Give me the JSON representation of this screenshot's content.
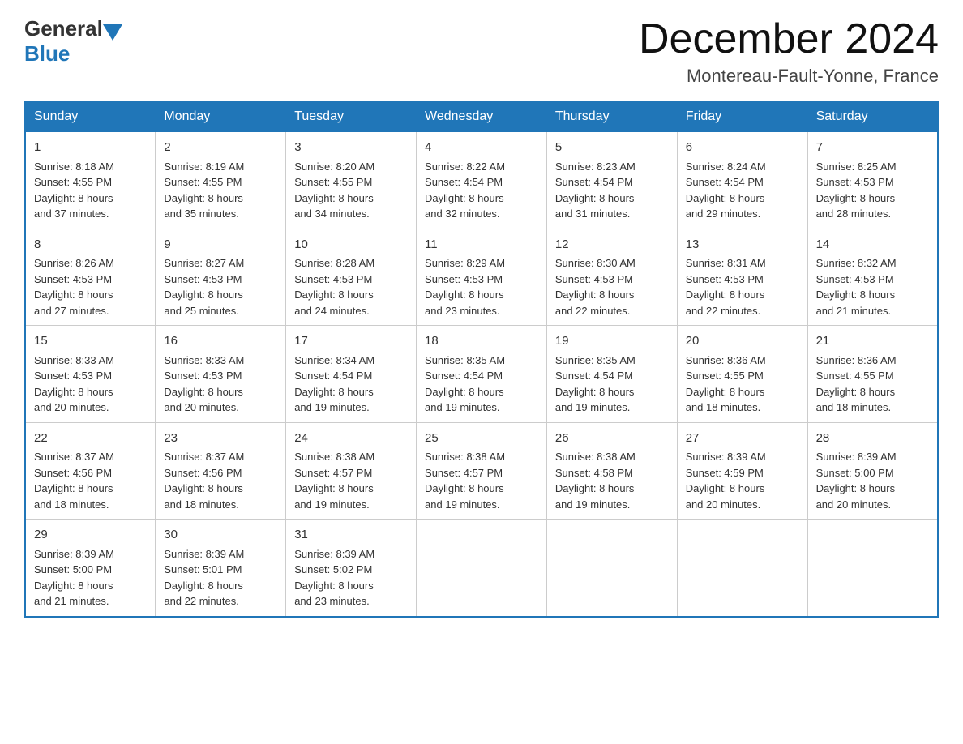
{
  "header": {
    "logo_general": "General",
    "logo_blue": "Blue",
    "month_title": "December 2024",
    "location": "Montereau-Fault-Yonne, France"
  },
  "weekdays": [
    "Sunday",
    "Monday",
    "Tuesday",
    "Wednesday",
    "Thursday",
    "Friday",
    "Saturday"
  ],
  "weeks": [
    [
      {
        "day": "1",
        "sunrise": "8:18 AM",
        "sunset": "4:55 PM",
        "daylight": "8 hours and 37 minutes."
      },
      {
        "day": "2",
        "sunrise": "8:19 AM",
        "sunset": "4:55 PM",
        "daylight": "8 hours and 35 minutes."
      },
      {
        "day": "3",
        "sunrise": "8:20 AM",
        "sunset": "4:55 PM",
        "daylight": "8 hours and 34 minutes."
      },
      {
        "day": "4",
        "sunrise": "8:22 AM",
        "sunset": "4:54 PM",
        "daylight": "8 hours and 32 minutes."
      },
      {
        "day": "5",
        "sunrise": "8:23 AM",
        "sunset": "4:54 PM",
        "daylight": "8 hours and 31 minutes."
      },
      {
        "day": "6",
        "sunrise": "8:24 AM",
        "sunset": "4:54 PM",
        "daylight": "8 hours and 29 minutes."
      },
      {
        "day": "7",
        "sunrise": "8:25 AM",
        "sunset": "4:53 PM",
        "daylight": "8 hours and 28 minutes."
      }
    ],
    [
      {
        "day": "8",
        "sunrise": "8:26 AM",
        "sunset": "4:53 PM",
        "daylight": "8 hours and 27 minutes."
      },
      {
        "day": "9",
        "sunrise": "8:27 AM",
        "sunset": "4:53 PM",
        "daylight": "8 hours and 25 minutes."
      },
      {
        "day": "10",
        "sunrise": "8:28 AM",
        "sunset": "4:53 PM",
        "daylight": "8 hours and 24 minutes."
      },
      {
        "day": "11",
        "sunrise": "8:29 AM",
        "sunset": "4:53 PM",
        "daylight": "8 hours and 23 minutes."
      },
      {
        "day": "12",
        "sunrise": "8:30 AM",
        "sunset": "4:53 PM",
        "daylight": "8 hours and 22 minutes."
      },
      {
        "day": "13",
        "sunrise": "8:31 AM",
        "sunset": "4:53 PM",
        "daylight": "8 hours and 22 minutes."
      },
      {
        "day": "14",
        "sunrise": "8:32 AM",
        "sunset": "4:53 PM",
        "daylight": "8 hours and 21 minutes."
      }
    ],
    [
      {
        "day": "15",
        "sunrise": "8:33 AM",
        "sunset": "4:53 PM",
        "daylight": "8 hours and 20 minutes."
      },
      {
        "day": "16",
        "sunrise": "8:33 AM",
        "sunset": "4:53 PM",
        "daylight": "8 hours and 20 minutes."
      },
      {
        "day": "17",
        "sunrise": "8:34 AM",
        "sunset": "4:54 PM",
        "daylight": "8 hours and 19 minutes."
      },
      {
        "day": "18",
        "sunrise": "8:35 AM",
        "sunset": "4:54 PM",
        "daylight": "8 hours and 19 minutes."
      },
      {
        "day": "19",
        "sunrise": "8:35 AM",
        "sunset": "4:54 PM",
        "daylight": "8 hours and 19 minutes."
      },
      {
        "day": "20",
        "sunrise": "8:36 AM",
        "sunset": "4:55 PM",
        "daylight": "8 hours and 18 minutes."
      },
      {
        "day": "21",
        "sunrise": "8:36 AM",
        "sunset": "4:55 PM",
        "daylight": "8 hours and 18 minutes."
      }
    ],
    [
      {
        "day": "22",
        "sunrise": "8:37 AM",
        "sunset": "4:56 PM",
        "daylight": "8 hours and 18 minutes."
      },
      {
        "day": "23",
        "sunrise": "8:37 AM",
        "sunset": "4:56 PM",
        "daylight": "8 hours and 18 minutes."
      },
      {
        "day": "24",
        "sunrise": "8:38 AM",
        "sunset": "4:57 PM",
        "daylight": "8 hours and 19 minutes."
      },
      {
        "day": "25",
        "sunrise": "8:38 AM",
        "sunset": "4:57 PM",
        "daylight": "8 hours and 19 minutes."
      },
      {
        "day": "26",
        "sunrise": "8:38 AM",
        "sunset": "4:58 PM",
        "daylight": "8 hours and 19 minutes."
      },
      {
        "day": "27",
        "sunrise": "8:39 AM",
        "sunset": "4:59 PM",
        "daylight": "8 hours and 20 minutes."
      },
      {
        "day": "28",
        "sunrise": "8:39 AM",
        "sunset": "5:00 PM",
        "daylight": "8 hours and 20 minutes."
      }
    ],
    [
      {
        "day": "29",
        "sunrise": "8:39 AM",
        "sunset": "5:00 PM",
        "daylight": "8 hours and 21 minutes."
      },
      {
        "day": "30",
        "sunrise": "8:39 AM",
        "sunset": "5:01 PM",
        "daylight": "8 hours and 22 minutes."
      },
      {
        "day": "31",
        "sunrise": "8:39 AM",
        "sunset": "5:02 PM",
        "daylight": "8 hours and 23 minutes."
      },
      null,
      null,
      null,
      null
    ]
  ],
  "labels": {
    "sunrise": "Sunrise:",
    "sunset": "Sunset:",
    "daylight": "Daylight:"
  }
}
